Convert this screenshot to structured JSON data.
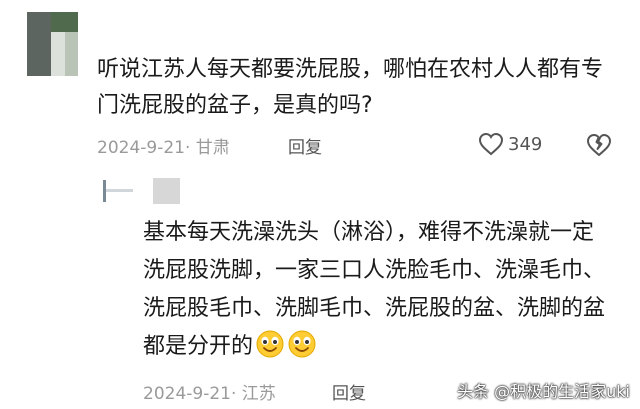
{
  "comment": {
    "text": "听说江苏人每天都要洗屁股，哪怕在农村人人都有专门洗屁股的盆子，是真的吗?",
    "date_location": "2024-9-21· 甘肃",
    "reply_label": "回复",
    "like_count": "349",
    "icons": {
      "like": "heart-outline-icon",
      "dislike": "broken-heart-icon"
    }
  },
  "reply": {
    "text": "基本每天洗澡洗头（淋浴），难得不洗澡就一定洗屁股洗脚，一家三口人洗脸毛巾、洗澡毛巾、洗屁股毛巾、洗脚毛巾、洗屁股的盆、洗脚的盆都是分开的",
    "emoji": "smiling-face-emoji",
    "date_location": "2024-9-21· 江苏",
    "reply_label": "回复"
  },
  "watermark": "头条 @积极的生活家uki"
}
